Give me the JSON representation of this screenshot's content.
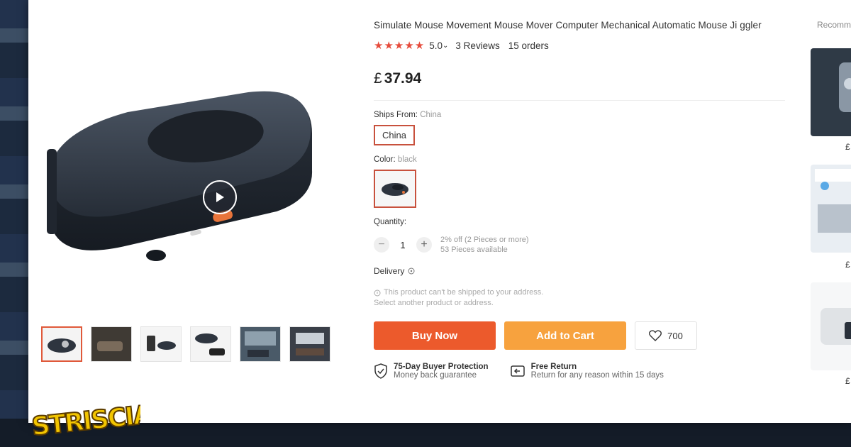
{
  "product": {
    "title": "Simulate Mouse Movement Mouse Mover Computer Mechanical Automatic Mouse Ji ggler",
    "stars": "★★★★★",
    "rating": "5.0",
    "rating_caret": "⌄",
    "reviews": "3 Reviews",
    "orders": "15 orders",
    "currency": "£",
    "price": "37.94"
  },
  "options": {
    "ships_from_label": "Ships From:",
    "ships_from_value": "China",
    "ships_from_option": "China",
    "color_label": "Color:",
    "color_value": "black"
  },
  "quantity": {
    "label": "Quantity:",
    "value": "1",
    "minus": "−",
    "plus": "+",
    "discount_note": "2% off (2 Pieces or more)",
    "available_note": "53 Pieces available"
  },
  "delivery": {
    "label": "Delivery",
    "warning_line1": "This product can't be shipped to your address.",
    "warning_line2": "Select another product or address."
  },
  "actions": {
    "buy_now": "Buy Now",
    "add_to_cart": "Add to Cart",
    "wishlist_count": "700"
  },
  "protection": {
    "buyer_title": "75-Day Buyer Protection",
    "buyer_sub": "Money back guarantee",
    "return_title": "Free Return",
    "return_sub": "Return for any reason within 15 days"
  },
  "sidebar": {
    "label": "Recomm",
    "prices": [
      "£",
      "£",
      "£"
    ]
  },
  "branding": {
    "logo_text": "STRISCIA"
  },
  "colors": {
    "accent_red": "#e64b3c",
    "buy_now": "#ec5a2c",
    "add_to_cart": "#f7a23e",
    "selected_border": "#c8513d"
  }
}
